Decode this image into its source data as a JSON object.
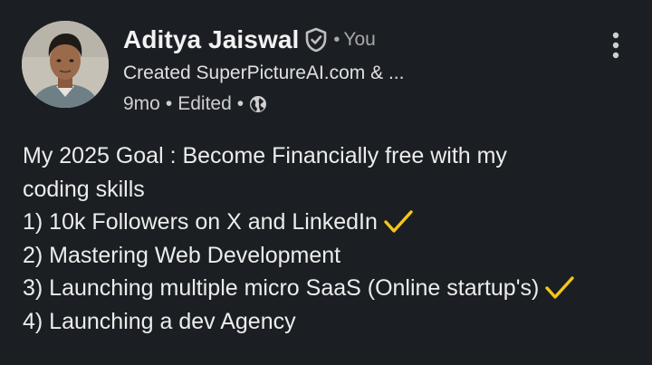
{
  "post": {
    "author": {
      "name": "Aditya Jaiswal",
      "relation": "You",
      "headline": "Created SuperPictureAI.com & ...",
      "age": "9mo",
      "edited_label": "Edited",
      "avatar_icon": "profile-photo",
      "verified_icon": "verified-shield-icon",
      "visibility_icon": "globe-icon"
    },
    "more_icon": "vertical-dots-icon",
    "body_lines": [
      "My 2025 Goal : Become Financially free with my",
      "coding skills",
      "1) 10k Followers on X and LinkedIn",
      "2) Mastering Web Development",
      "3) Launching multiple micro SaaS (Online startup's)",
      "4) Launching a dev Agency"
    ],
    "completed_items": [
      2,
      4
    ],
    "check_color": "#f5c518"
  },
  "colors": {
    "background": "#1b1f23",
    "text_primary": "#ececec",
    "text_muted": "#a8a8a8"
  }
}
